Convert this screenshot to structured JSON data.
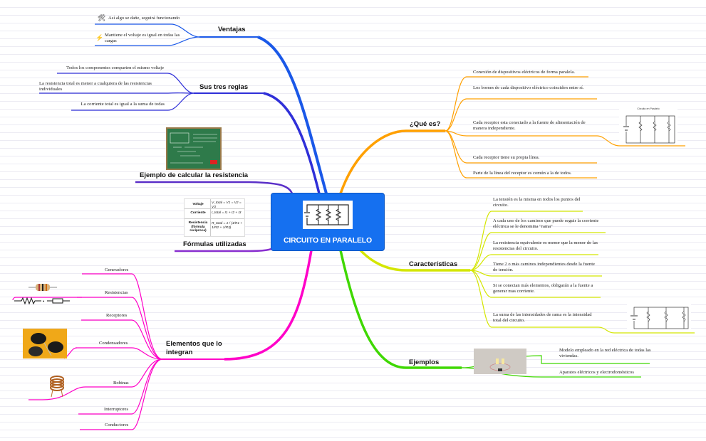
{
  "central": {
    "title": "CIRCUITO EN PARALELO"
  },
  "ventajas": {
    "title": "Ventajas",
    "items": [
      {
        "text": "Así algo se dañe, seguirá funcionando",
        "icon": "tools-icon"
      },
      {
        "text": "Mantiene el voltaje es igual en todas las cargas",
        "icon": "lightning-icon"
      }
    ]
  },
  "reglas": {
    "title": "Sus tres reglas",
    "items": [
      "Todos los componentes comparten el mismo voltaje",
      "La resistencia total es menor a cualquiera de las resistencias individuales",
      "La corriente total es igual a la suma de todas"
    ]
  },
  "ejemplo_resistencia": {
    "title": "Ejemplo de calcular la resistencia"
  },
  "formulas": {
    "title": "Fórmulas utilizadas",
    "rows": [
      {
        "label": "Voltaje",
        "formula": "V_total = V1 = V2 = V3"
      },
      {
        "label": "Corriente",
        "formula": "I_total = I1 + I2 + I3"
      },
      {
        "label": "Resistencia (fórmula recíproca)",
        "formula": "R_total = 1 / (1/R1 + 1/R2 + 1/R3)"
      }
    ]
  },
  "elementos": {
    "title": "Elementos que lo integran",
    "items": [
      "Generadores",
      "Resistencias",
      "Receptores",
      "Condensadores",
      "Bobinas",
      "Interruptores",
      "Conductores"
    ]
  },
  "que_es": {
    "title": "¿Qué es?",
    "items": [
      "Conexión de dispositivos eléctricos de forma paralela.",
      "Los bornes de cada dispositivo eléctrico coinciden entre sí.",
      "Cada receptor esta conectado a la fuente de alimentación de manera independiente.",
      "Cada receptor tiene su propia línea.",
      "Parte de la línea del receptor es común a la de todos."
    ],
    "image_caption": "Circuito en Paralelo"
  },
  "caracteristicas": {
    "title": "Características",
    "items": [
      "La tensión es la misma en todos los puntos del circuito.",
      "A cada uno de los caminos que puede seguir la corriente eléctrica se le denomina \"rama\"",
      "La resistencia equivalente es menor que la menor de las resistencias del circuito.",
      "Tiene 2 o más caminos independientes desde la fuente de tensión.",
      "Si se conectan más elementos, obligarán a la fuente a generar mas corriente.",
      "La suma de las intensidades de rama es la intensidad total del circuito."
    ]
  },
  "ejemplos": {
    "title": "Ejemplos",
    "items": [
      "Modelo empleado en la red eléctrica de todas las viviendas.",
      "Aparatos eléctricos y electrodomésticos"
    ]
  },
  "colors": {
    "ventajas": "#1a58e8",
    "reglas": "#2f2fd8",
    "ejemplo": "#5a2fc8",
    "formulas": "#8a2fd0",
    "elementos": "#ff00c8",
    "que_es": "#ffa000",
    "caracteristicas": "#d4e600",
    "ejemplos": "#3fd800",
    "central": "#1570f0"
  }
}
